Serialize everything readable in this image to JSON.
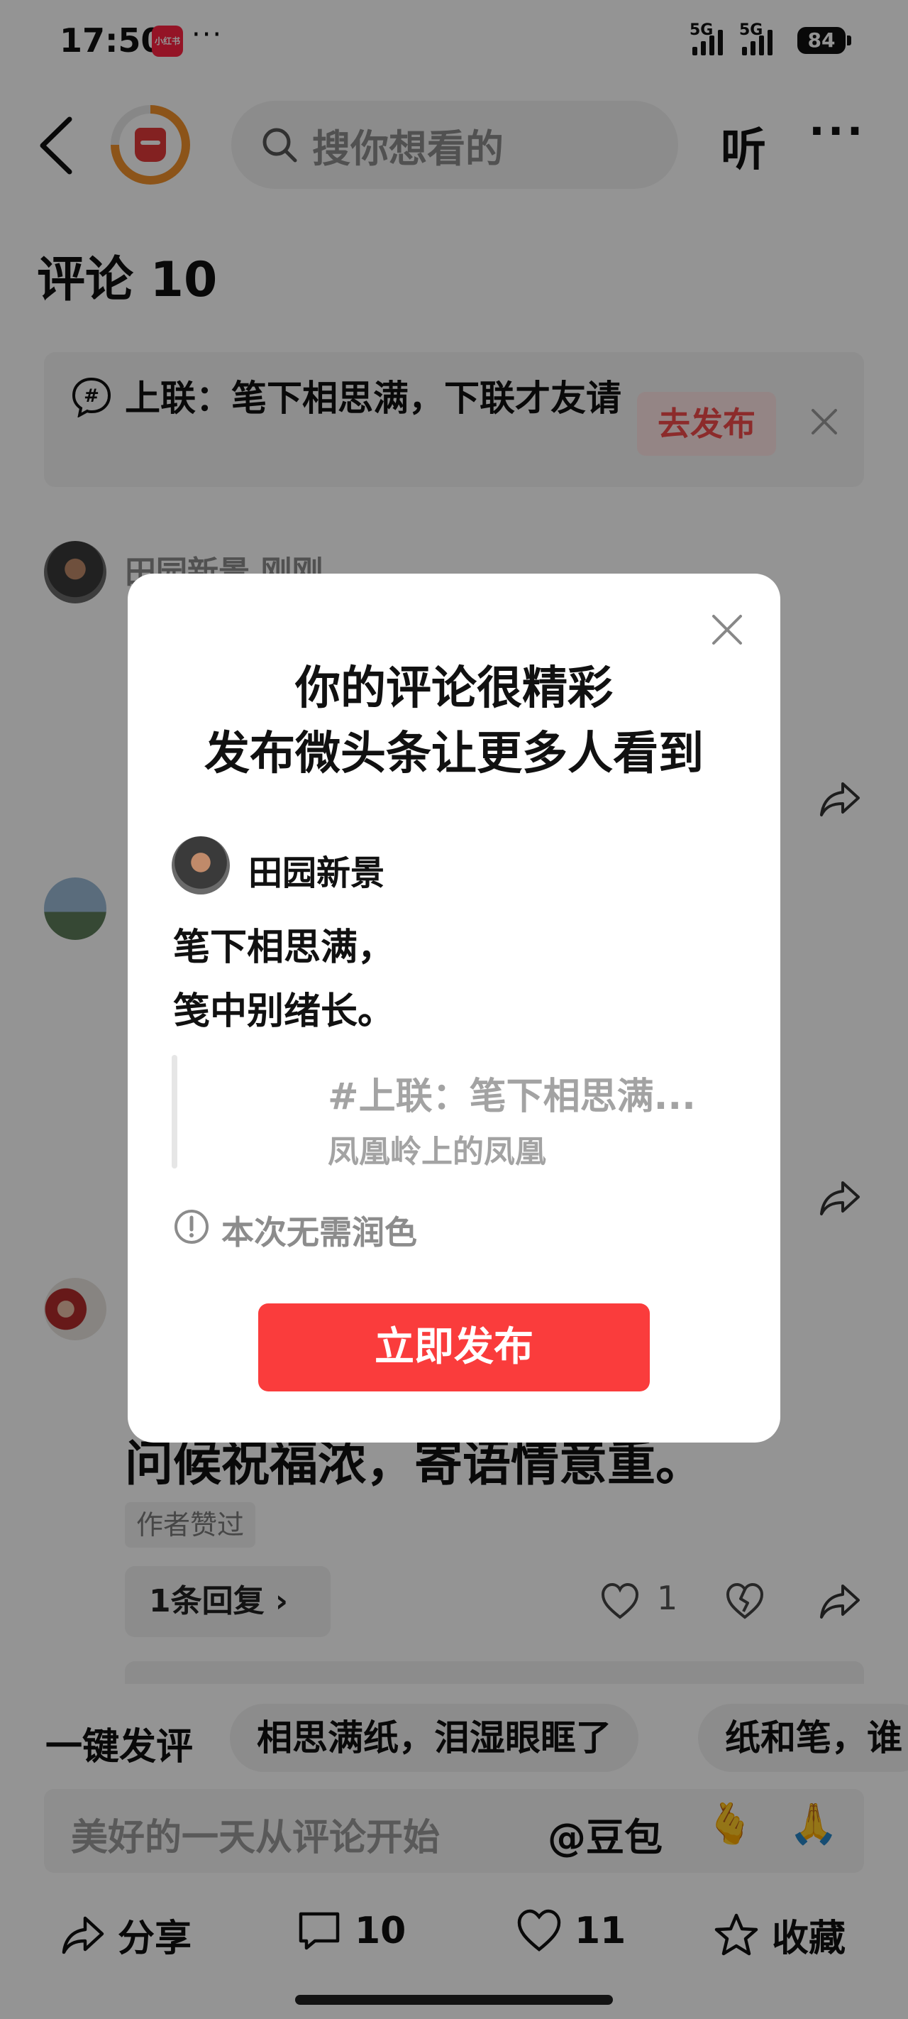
{
  "status_bar": {
    "time": "17:50",
    "app_badge": "小红书",
    "dots": "···",
    "signal1": "5G",
    "signal2": "5G",
    "battery": "84"
  },
  "header": {
    "search_placeholder": "搜你想看的",
    "listen_label": "听",
    "more_label": "···",
    "back_icon": "chevron-left-icon",
    "logo_icon": "app-logo-icon"
  },
  "comments": {
    "title": "评论 10",
    "topic_banner": {
      "text": "上联：笔下相思满，下联才友请",
      "publish_label": "去发布"
    },
    "first_user": "田园新景  刚刚",
    "visible_verse": "问候祝福浓，寄语情意重。",
    "author_liked": "作者赞过",
    "reply_label": "1条回复 ›",
    "like_count": "1"
  },
  "quick_comment": {
    "label": "一键发评",
    "chips": [
      "相思满纸，泪湿眼眶了",
      "纸和笔，谁"
    ]
  },
  "comment_input": {
    "placeholder": "美好的一天从评论开始",
    "doubao": "@豆包",
    "emoji1": "🫰",
    "emoji2": "🙏"
  },
  "bottom_bar": {
    "share": "分享",
    "comments": "10",
    "likes": "11",
    "favorite": "收藏"
  },
  "dialog": {
    "title_line1": "你的评论很精彩",
    "title_line2": "发布微头条让更多人看到",
    "username": "田园新景",
    "verse_line1": "笔下相思满，",
    "verse_line2": "笺中别绪长。",
    "quote_title": "#上联：笔下相思满...",
    "quote_source": "凤凰岭上的凤凰",
    "notice": "本次无需润色",
    "publish_button": "立即发布"
  },
  "colors": {
    "accent_red": "#fa3c3c",
    "publish_chip_bg": "#ffe5e5",
    "logo_orange": "#f2922b",
    "overlay": "rgba(0,0,0,0.42)"
  }
}
